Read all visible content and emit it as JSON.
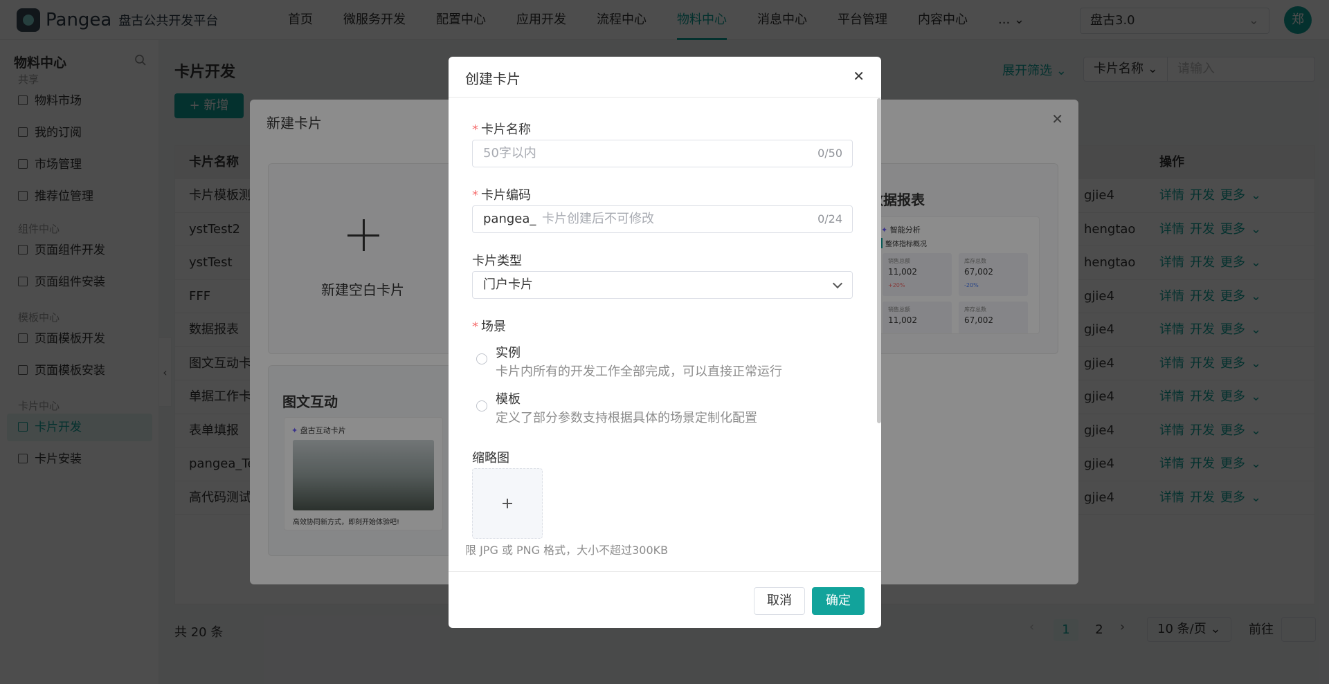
{
  "header": {
    "brand": "Pangea",
    "platform": "盘古公共开发平台",
    "nav": [
      "首页",
      "微服务开发",
      "配置中心",
      "应用开发",
      "流程中心",
      "物料中心",
      "消息中心",
      "平台管理",
      "内容中心",
      "..."
    ],
    "active_nav": "物料中心",
    "tenant": "盘古3.0",
    "avatar": "郑",
    "accent_color": "#12a39b"
  },
  "sidebar": {
    "title": "物料中心",
    "groups": [
      {
        "label": "共享",
        "items": [
          "物料市场",
          "我的订阅",
          "市场管理",
          "推荐位管理"
        ]
      },
      {
        "label": "组件中心",
        "items": [
          "页面组件开发",
          "页面组件安装"
        ]
      },
      {
        "label": "模板中心",
        "items": [
          "页面模板开发",
          "页面模板安装"
        ]
      },
      {
        "label": "卡片中心",
        "items": [
          "卡片开发",
          "卡片安装"
        ]
      }
    ],
    "active_item": "卡片开发"
  },
  "main": {
    "title": "卡片开发",
    "new_button": "+ 新增",
    "expand_filter": "展开筛选",
    "filter_field": "卡片名称",
    "filter_placeholder": "请输入",
    "columns": {
      "name": "卡片名称",
      "ops": "操作"
    },
    "rows": [
      {
        "name": "卡片模板测",
        "owner": "gjie4"
      },
      {
        "name": "ystTest2",
        "owner": "hengtao"
      },
      {
        "name": "ystTest",
        "owner": "hengtao"
      },
      {
        "name": "FFF",
        "owner": "gjie4"
      },
      {
        "name": "数据报表",
        "owner": "gjie4"
      },
      {
        "name": "图文互动卡",
        "owner": "gjie4"
      },
      {
        "name": "单据工作卡",
        "owner": "gjie4"
      },
      {
        "name": "表单填报",
        "owner": "gjie4"
      },
      {
        "name": "pangea_Te",
        "owner": "gjie4"
      },
      {
        "name": "高代码测试",
        "owner": "gjie4"
      }
    ],
    "row_ops": [
      "详情",
      "开发",
      "更多"
    ],
    "total": "共 20 条",
    "pages": [
      "1",
      "2"
    ],
    "page_size": "10 条/页",
    "goto": "前往"
  },
  "background_dialog": {
    "title": "新建卡片",
    "blank_card": "新建空白卡片",
    "template_cards": [
      {
        "title": "图文互动",
        "inner_title": "盘古互动卡片",
        "caption": "高效协同新方式，即刻开始体验吧!"
      },
      {
        "title": "数据报表",
        "inner_title": "智能分析",
        "inner_sub": "整体指标概况",
        "metrics": [
          {
            "label": "销售总额",
            "value": "11,002",
            "delta": "+20%"
          },
          {
            "label": "库存总数",
            "value": "67,002",
            "delta": "-20%"
          },
          {
            "label": "销售总额",
            "value": "11,002"
          },
          {
            "label": "库存总数",
            "value": "67,002"
          }
        ]
      }
    ]
  },
  "modal": {
    "title": "创建卡片",
    "name_label": "卡片名称",
    "name_placeholder": "50字以内",
    "name_count": "0/50",
    "code_label": "卡片编码",
    "code_prefix": "pangea_",
    "code_placeholder": "卡片创建后不可修改",
    "code_count": "0/24",
    "type_label": "卡片类型",
    "type_value": "门户卡片",
    "scene_label": "场景",
    "scene_options": [
      {
        "title": "实例",
        "desc": "卡片内所有的开发工作全部完成，可以直接正常运行"
      },
      {
        "title": "模板",
        "desc": "定义了部分参数支持根据具体的场景定制化配置"
      }
    ],
    "thumb_label": "缩略图",
    "upload_tip": "限 JPG 或 PNG 格式，大小不超过300KB",
    "cancel": "取消",
    "confirm": "确定"
  }
}
